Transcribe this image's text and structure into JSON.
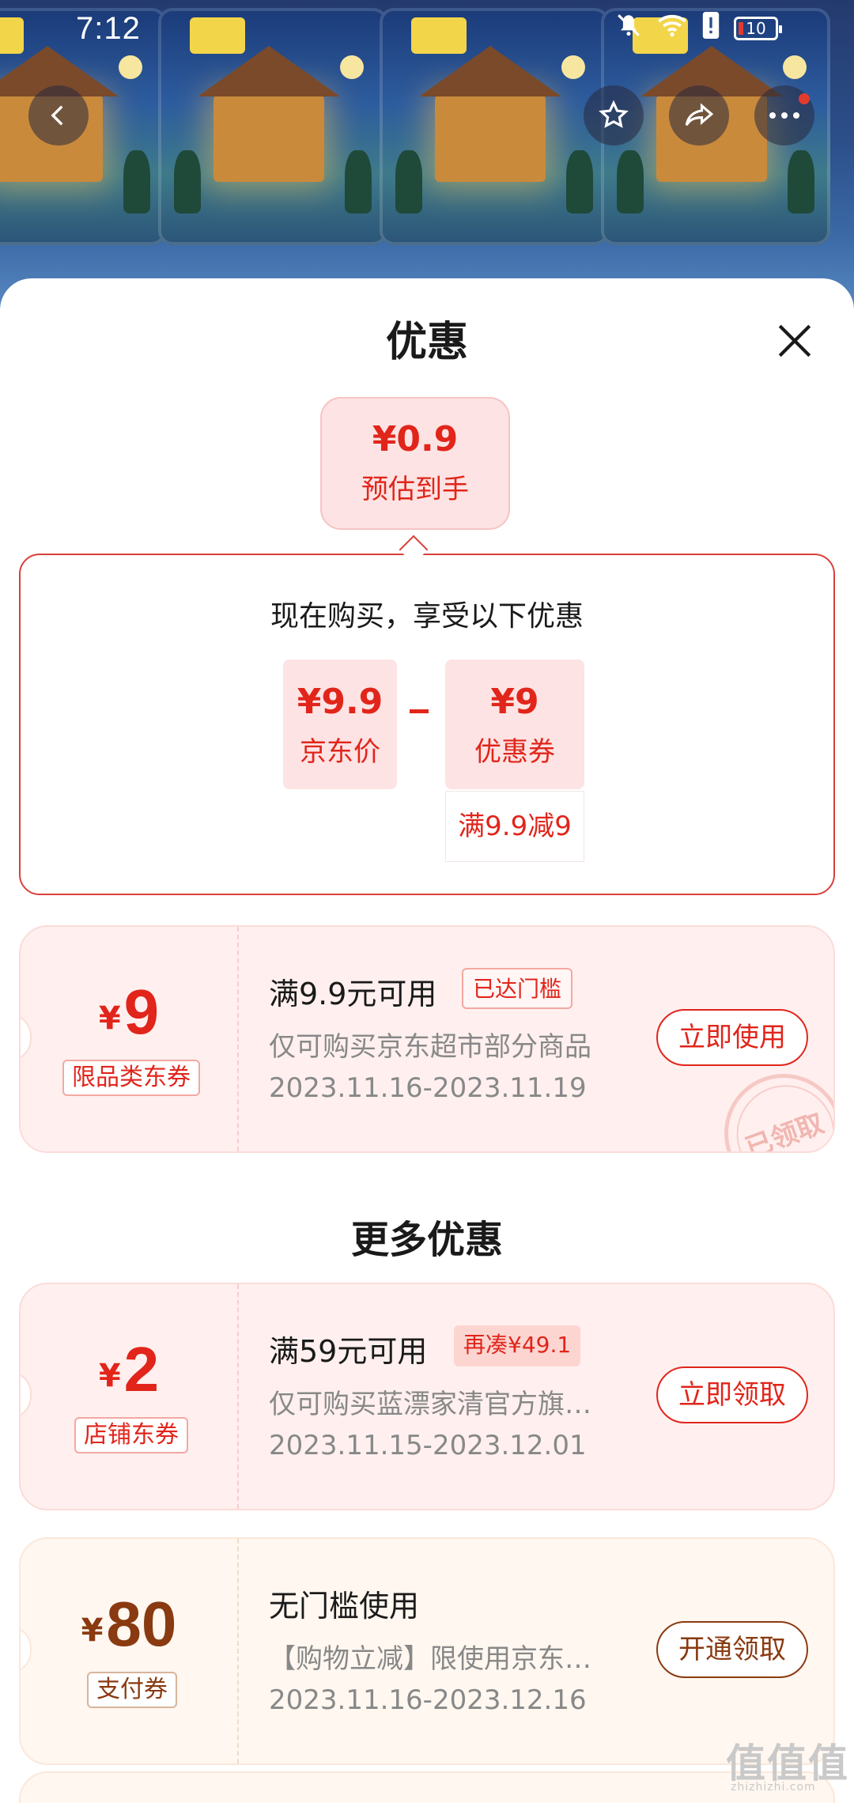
{
  "status_bar": {
    "time": "7:12",
    "battery": "10",
    "icons": [
      "bell-off-icon",
      "wifi-icon",
      "alert-icon",
      "battery-icon"
    ]
  },
  "header_nav": {
    "back_icon": "chevron-left-icon",
    "favorite_icon": "star-icon",
    "share_icon": "share-icon",
    "more_icon": "more-icon"
  },
  "sheet": {
    "title": "优惠",
    "close_icon": "close-icon",
    "estimate": {
      "price": "¥0.9",
      "label": "预估到手"
    },
    "benefit": {
      "title": "现在购买，享受以下优惠",
      "items": [
        {
          "amount": "¥9.9",
          "label": "京东价"
        },
        {
          "amount": "¥9",
          "label": "优惠券",
          "sub": "满9.9减9"
        }
      ]
    }
  },
  "coupons": [
    {
      "yen": "¥",
      "value": "9",
      "tag": "限品类东券",
      "condition": "满9.9元可用",
      "badge": "已达门槛",
      "description": "仅可购买京东超市部分商品",
      "date": "2023.11.16-2023.11.19",
      "button": "立即使用",
      "stamp": "已领取"
    }
  ],
  "more_section": {
    "title": "更多优惠",
    "coupons": [
      {
        "yen": "¥",
        "value": "2",
        "tag": "店铺东券",
        "condition": "满59元可用",
        "badge": "再凑¥49.1",
        "description": "仅可购买蓝漂家清官方旗…",
        "date": "2023.11.15-2023.12.01",
        "button": "立即领取"
      },
      {
        "yen": "¥",
        "value": "80",
        "tag": "支付券",
        "condition": "无门槛使用",
        "description": "【购物立减】限使用京东…",
        "date": "2023.11.16-2023.12.16",
        "button": "开通领取"
      }
    ]
  },
  "watermark": {
    "text": "值值值",
    "url": "zhizhizhi.com"
  },
  "colors": {
    "accent": "#e1251b",
    "gold": "#8a3a10",
    "pink_bg": "#fde3e3"
  }
}
